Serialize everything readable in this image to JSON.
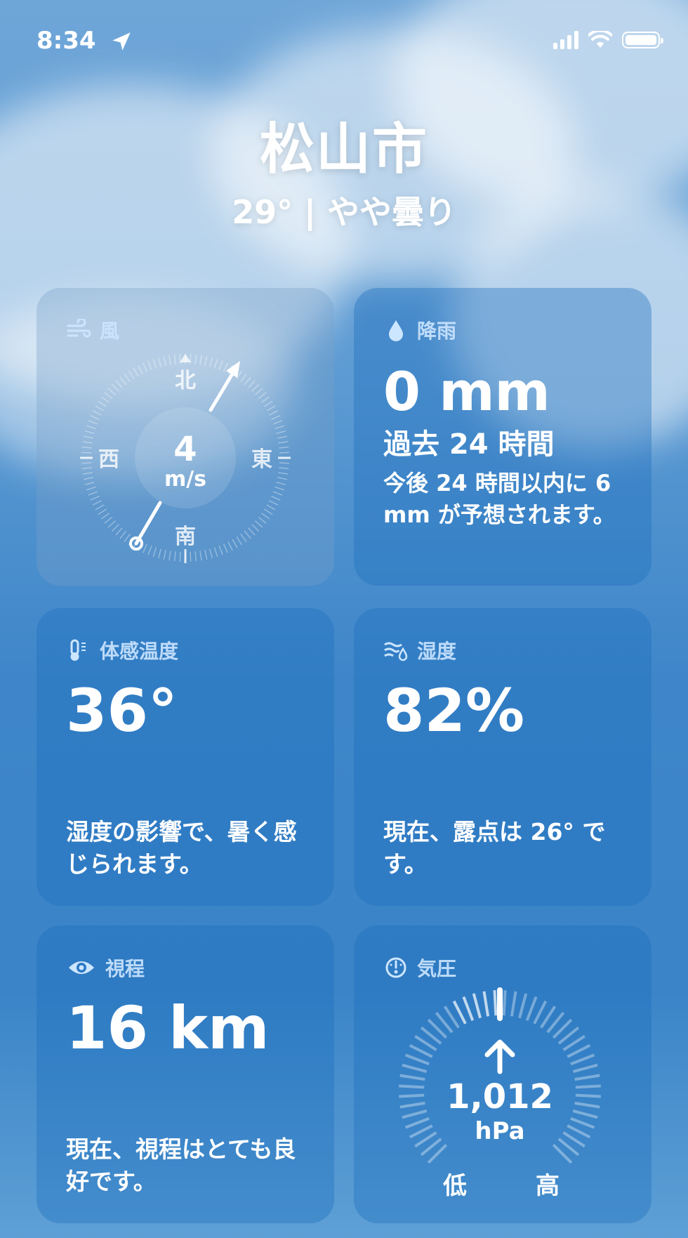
{
  "status_bar": {
    "time": "8:34",
    "icons": [
      "location-arrow-icon",
      "cellular-signal-icon",
      "wifi-icon",
      "battery-icon"
    ]
  },
  "header": {
    "city": "松山市",
    "condition": "29° | やや曇り"
  },
  "wind": {
    "title": "風",
    "speed": "4",
    "unit": "m/s",
    "directions": {
      "north": "北",
      "south": "南",
      "east": "東",
      "west": "西"
    },
    "direction_deg": 30
  },
  "rain": {
    "title": "降雨",
    "amount": "0 mm",
    "period": "過去 24 時間",
    "description": "今後 24 時間以内に 6 mm が予想されます。"
  },
  "feels_like": {
    "title": "体感温度",
    "value": "36°",
    "description": "湿度の影響で、暑く感じられます。"
  },
  "humidity": {
    "title": "湿度",
    "value": "82%",
    "description": "現在、露点は 26° です。"
  },
  "visibility": {
    "title": "視程",
    "value": "16 km",
    "description": "現在、視程はとても良好です。"
  },
  "pressure": {
    "title": "気圧",
    "value": "1,012",
    "unit": "hPa",
    "low_label": "低",
    "high_label": "高",
    "trend": "rising"
  },
  "colors": {
    "card": "#2a78c4",
    "label": "#cde6ff"
  }
}
